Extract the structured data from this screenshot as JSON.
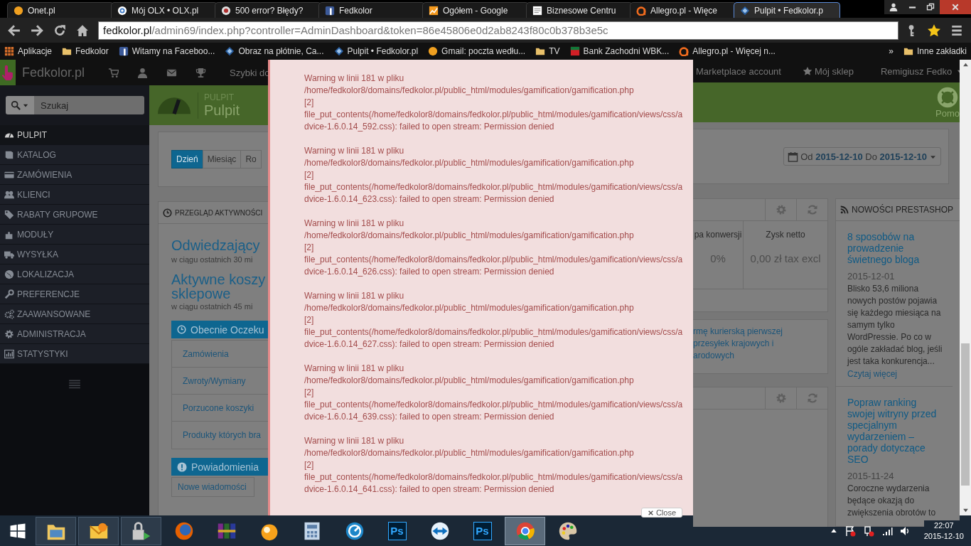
{
  "browser": {
    "tabs": [
      {
        "title": "Onet.pl",
        "kind": "circle",
        "selected": false
      },
      {
        "title": "Mój OLX • OLX.pl",
        "kind": "ring",
        "selected": false
      },
      {
        "title": "500 error? Błędy?",
        "kind": "dot",
        "selected": false
      },
      {
        "title": "Fedkolor",
        "kind": "square",
        "selected": false
      },
      {
        "title": "Ogółem - Google",
        "kind": "chart",
        "selected": false
      },
      {
        "title": "Biznesowe Centru",
        "kind": "page",
        "selected": false
      },
      {
        "title": "Allegro.pl - Więce",
        "kind": "arc",
        "selected": false
      },
      {
        "title": "Pulpit • Fedkolor.p",
        "kind": "diamond",
        "selected": true
      }
    ],
    "url": {
      "host": "fedkolor.pl",
      "path": "/admin69/index.php?controller=AdminDashboard&token=86e45806e0d2ab8243f80c0b378b3e5c"
    },
    "bookmarks": [
      {
        "label": "Aplikacje",
        "kind": "grid"
      },
      {
        "label": "Fedkolor",
        "kind": "folder"
      },
      {
        "label": "Witamy na Faceboo...",
        "kind": "square"
      },
      {
        "label": "Obraz na płótnie, Ca...",
        "kind": "diamond"
      },
      {
        "label": "Pulpit • Fedkolor.pl",
        "kind": "diamond"
      },
      {
        "label": "Gmail: poczta wedłu...",
        "kind": "circle"
      },
      {
        "label": "TV",
        "kind": "folder"
      },
      {
        "label": "Bank Zachodni WBK...",
        "kind": "flag"
      },
      {
        "label": "Allegro.pl - Więcej n...",
        "kind": "arc"
      }
    ],
    "more_bookmarks": "»",
    "other_bookmarks": "Inne zakładki"
  },
  "admin": {
    "header": {
      "shop_name": "Fedkolor.pl",
      "quick_access": "Szybki do",
      "marketplace": "Marketplace account",
      "my_shop": "Mój sklep",
      "user": "Remigiusz Fedko"
    },
    "search": {
      "placeholder": "Szukaj"
    },
    "menu": [
      {
        "label": "PULPIT",
        "kind": "dashboard",
        "selected": true
      },
      {
        "label": "KATALOG",
        "kind": "catalog",
        "selected": false
      },
      {
        "label": "ZAMÓWIENIA",
        "kind": "orders",
        "selected": false
      },
      {
        "label": "KLIENCI",
        "kind": "customers",
        "selected": false
      },
      {
        "label": "RABATY GRUPOWE",
        "kind": "discounts",
        "selected": false
      },
      {
        "label": "MODUŁY",
        "kind": "modules",
        "selected": false
      },
      {
        "label": "WYSYŁKA",
        "kind": "shipping",
        "selected": false
      },
      {
        "label": "LOKALIZACJA",
        "kind": "localization",
        "selected": false
      },
      {
        "label": "PREFERENCJE",
        "kind": "preferences",
        "selected": false
      },
      {
        "label": "ZAAWANSOWANE",
        "kind": "advanced",
        "selected": false
      },
      {
        "label": "ADMINISTRACJA",
        "kind": "administration",
        "selected": false
      },
      {
        "label": "STATYSTYKI",
        "kind": "stats",
        "selected": false
      }
    ],
    "page_header": {
      "breadcrumb": "PULPIT",
      "title": "Pulpit",
      "help": "Pomo"
    },
    "period_buttons": [
      {
        "label": "Dzień",
        "selected": true
      },
      {
        "label": "Miesiąc",
        "selected": false
      },
      {
        "label": "Ro",
        "selected": false
      }
    ],
    "date_range": "Od **2015-12-10** Do **2015-12-10**",
    "activity": {
      "title": "PRZEGLĄD AKTYWNOŚCI",
      "visitors": "Odwiedzający",
      "visitors_note": "w ciągu ostatnich 30 mi",
      "carts": "Aktywne koszy sklepowe",
      "carts_note": "w ciągu ostatnich 45 mi",
      "pending_title": "Obecnie Oczeku",
      "pending_items": [
        "Zamówienia",
        "Zwroty/Wymiany",
        "Porzucone koszyki",
        "Produkty których bra"
      ],
      "notifications_title": "Powiadomienia",
      "notifications_tab": "Nowe wiadomości"
    },
    "goals": {
      "columns": [
        {
          "label": "pa konwersji",
          "value": "0%"
        },
        {
          "label": "Zysk netto",
          "value": "0,00 zł tax excl"
        }
      ]
    },
    "carrier_lines": [
      "rmę kurierską pierwszej",
      "przesyłek krajowych i",
      "arodowych"
    ],
    "news": {
      "title": "NOWOŚCI PRESTASHOP",
      "articles": [
        {
          "title": "8 sposobów na prowadzenie świetnego bloga",
          "date": "2015-12-01",
          "excerpt": "Blisko 53,6 miliona nowych postów pojawia się każdego miesiąca na samym tylko WordPressie. Po co w ogóle zakładać blog, jeśli jest taka konkurencja...",
          "more": "Czytaj więcej"
        },
        {
          "title": "Popraw ranking swojej witryny przed specjalnym wydarzeniem – porady dotyczące SEO",
          "date": "2015-11-24",
          "excerpt": "Coroczne wydarzenia będące okazją do zwiększenia obrotów to"
        }
      ]
    }
  },
  "modal": {
    "warnings": [
      {
        "heading": "Warning w linii 181 w pliku",
        "file": "/home/fedkolor8/domains/fedkolor.pl/public_html/modules/gamification/gamification.php",
        "code": "[2]",
        "message": "file_put_contents(/home/fedkolor8/domains/fedkolor.pl/public_html/modules/gamification/views/css/advice-1.6.0.14_592.css): failed to open stream: Permission denied"
      },
      {
        "heading": "Warning w linii 181 w pliku",
        "file": "/home/fedkolor8/domains/fedkolor.pl/public_html/modules/gamification/gamification.php",
        "code": "[2]",
        "message": "file_put_contents(/home/fedkolor8/domains/fedkolor.pl/public_html/modules/gamification/views/css/advice-1.6.0.14_623.css): failed to open stream: Permission denied"
      },
      {
        "heading": "Warning w linii 181 w pliku",
        "file": "/home/fedkolor8/domains/fedkolor.pl/public_html/modules/gamification/gamification.php",
        "code": "[2]",
        "message": "file_put_contents(/home/fedkolor8/domains/fedkolor.pl/public_html/modules/gamification/views/css/advice-1.6.0.14_626.css): failed to open stream: Permission denied"
      },
      {
        "heading": "Warning w linii 181 w pliku",
        "file": "/home/fedkolor8/domains/fedkolor.pl/public_html/modules/gamification/gamification.php",
        "code": "[2]",
        "message": "file_put_contents(/home/fedkolor8/domains/fedkolor.pl/public_html/modules/gamification/views/css/advice-1.6.0.14_627.css): failed to open stream: Permission denied"
      },
      {
        "heading": "Warning w linii 181 w pliku",
        "file": "/home/fedkolor8/domains/fedkolor.pl/public_html/modules/gamification/gamification.php",
        "code": "[2]",
        "message": "file_put_contents(/home/fedkolor8/domains/fedkolor.pl/public_html/modules/gamification/views/css/advice-1.6.0.14_639.css): failed to open stream: Permission denied"
      },
      {
        "heading": "Warning w linii 181 w pliku",
        "file": "/home/fedkolor8/domains/fedkolor.pl/public_html/modules/gamification/gamification.php",
        "code": "[2]",
        "message": "file_put_contents(/home/fedkolor8/domains/fedkolor.pl/public_html/modules/gamification/views/css/advice-1.6.0.14_641.css): failed to open stream: Permission denied"
      }
    ],
    "close": "Close"
  },
  "taskbar": {
    "apps": [
      {
        "kind": "folder",
        "running": true,
        "selected": false
      },
      {
        "kind": "envelope",
        "running": true,
        "selected": false
      },
      {
        "kind": "padlock",
        "running": true,
        "selected": false
      },
      {
        "kind": "globe",
        "running": false,
        "selected": false
      },
      {
        "kind": "archive",
        "running": false,
        "selected": false
      },
      {
        "kind": "sphere",
        "running": false,
        "selected": false
      },
      {
        "kind": "calculator",
        "running": false,
        "selected": false
      },
      {
        "kind": "dial",
        "running": false,
        "selected": false
      },
      {
        "kind": "ps",
        "label": "Ps",
        "running": false,
        "selected": false
      },
      {
        "kind": "arrows",
        "running": false,
        "selected": false
      },
      {
        "kind": "ps",
        "label": "Ps",
        "running": false,
        "selected": false
      },
      {
        "kind": "wheel",
        "running": true,
        "selected": true
      },
      {
        "kind": "palette",
        "running": false,
        "selected": false
      }
    ],
    "time": "22:07",
    "date": "2015-12-10"
  }
}
